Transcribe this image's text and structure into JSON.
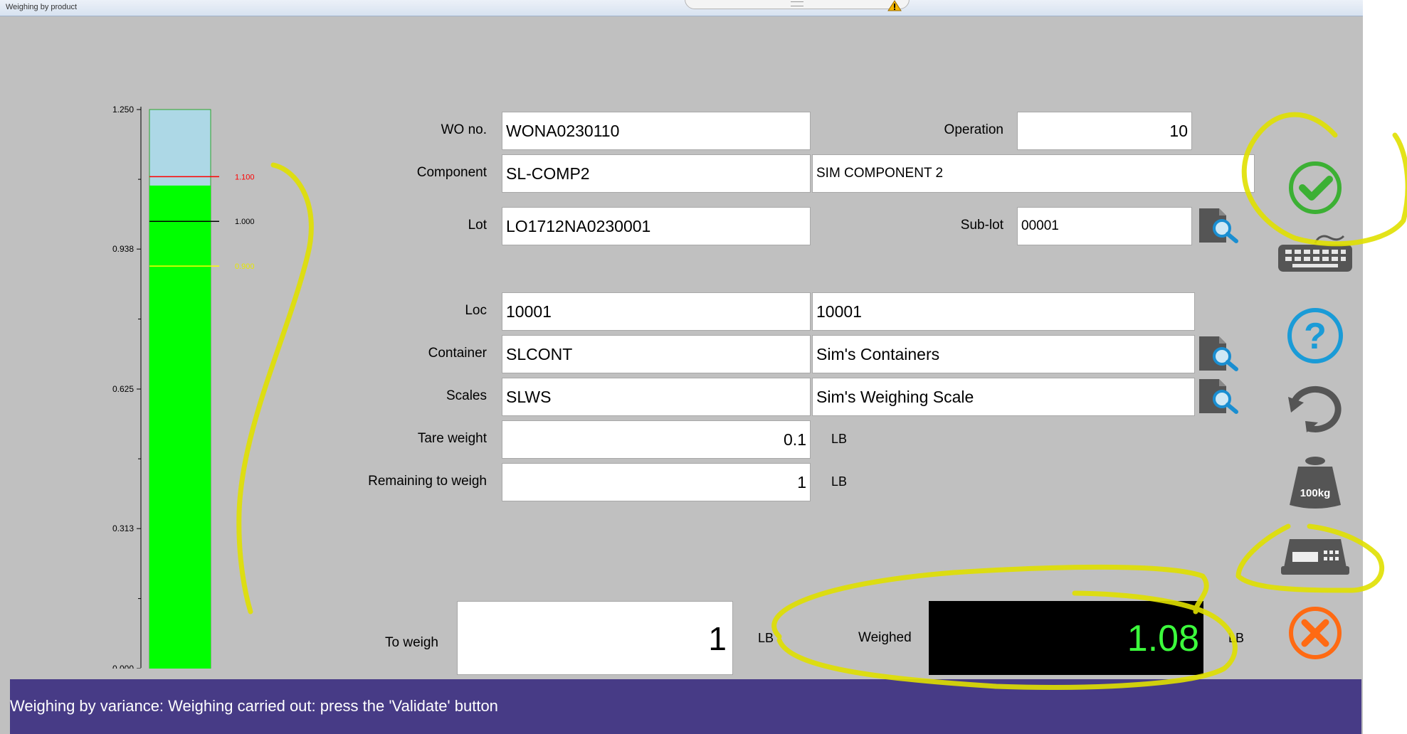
{
  "window": {
    "title": "Weighing by product"
  },
  "gauge": {
    "ticks": [
      "1.250",
      "0.938",
      "0.625",
      "0.313",
      "0.000"
    ],
    "max": 1.25,
    "fill_value": 1.08,
    "markers": [
      {
        "value": 1.1,
        "label": "1.100",
        "color": "#ff0000"
      },
      {
        "value": 1.0,
        "label": "1.000",
        "color": "#000000"
      },
      {
        "value": 0.9,
        "label": "0.900",
        "color": "#ffff00"
      }
    ],
    "colors": {
      "fill": "#00ff00",
      "empty": "#add8e6"
    }
  },
  "form": {
    "wo_no": {
      "label": "WO no.",
      "value": "WONA0230110"
    },
    "operation": {
      "label": "Operation",
      "value": "10"
    },
    "component": {
      "label": "Component",
      "code": "SL-COMP2",
      "description": "SIM COMPONENT 2"
    },
    "lot": {
      "label": "Lot",
      "value": "LO1712NA0230001"
    },
    "sublot": {
      "label": "Sub-lot",
      "value": "00001"
    },
    "loc": {
      "label": "Loc",
      "code": "10001",
      "description": "10001"
    },
    "container": {
      "label": "Container",
      "code": "SLCONT",
      "description": "Sim's Containers"
    },
    "scales": {
      "label": "Scales",
      "code": "SLWS",
      "description": "Sim's Weighing Scale"
    },
    "tare": {
      "label": "Tare weight",
      "value": "0.1",
      "unit": "LB"
    },
    "remaining": {
      "label": "Remaining to weigh",
      "value": "1",
      "unit": "LB"
    },
    "to_weigh": {
      "label": "To weigh",
      "value": "1",
      "unit": "LB"
    },
    "weighed": {
      "label": "Weighed",
      "value": "1.08",
      "unit": "LB"
    }
  },
  "toolbar": {
    "validate": {
      "icon": "check-icon",
      "color": "#3cb034"
    },
    "keyboard": {
      "icon": "keyboard-icon",
      "color": "#555555"
    },
    "help": {
      "icon": "help-icon",
      "glyph": "?",
      "color": "#1a9bd7"
    },
    "reset": {
      "icon": "refresh-icon",
      "color": "#555555"
    },
    "tare_weight": {
      "icon": "weight-icon",
      "text": "100kg",
      "color": "#555555"
    },
    "scale_read": {
      "icon": "scale-icon",
      "color": "#555555"
    },
    "cancel": {
      "icon": "close-icon",
      "color": "#ff6a13"
    }
  },
  "status": {
    "message": "Weighing  by variance: Weighing carried out: press the 'Validate' button",
    "bg": "#473b86"
  },
  "colors": {
    "panel": "#c0c0c0",
    "display_bg": "#000000",
    "display_fg": "#3cff3c",
    "highlighter": "#e0e000"
  }
}
